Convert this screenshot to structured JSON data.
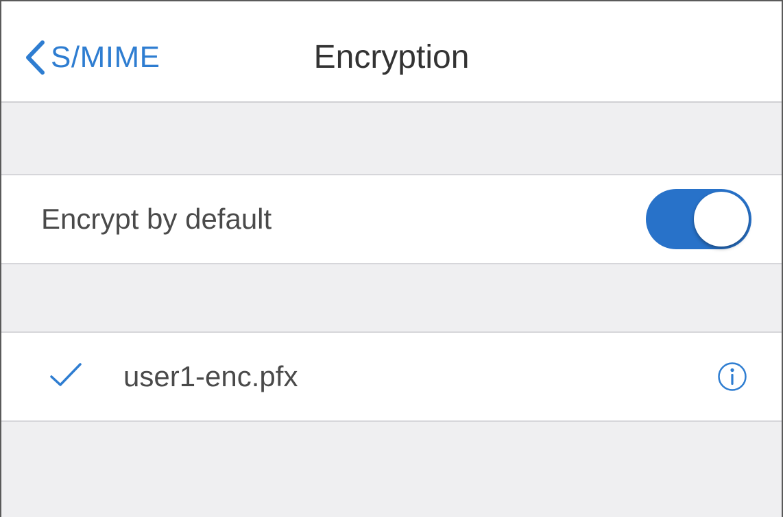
{
  "navbar": {
    "back_label": "S/MIME",
    "title": "Encryption",
    "back_icon": "chevron-left-icon"
  },
  "settings": {
    "encrypt_by_default": {
      "label": "Encrypt by default",
      "enabled": true
    }
  },
  "certificates": [
    {
      "name": "user1-enc.pfx",
      "selected": true,
      "icon_selected": "checkmark-icon",
      "icon_info": "info-icon"
    }
  ],
  "colors": {
    "accent": "#2e7dd1",
    "toggle_on": "#2872c9",
    "background": "#efeff1",
    "text": "#4a4a4a"
  }
}
